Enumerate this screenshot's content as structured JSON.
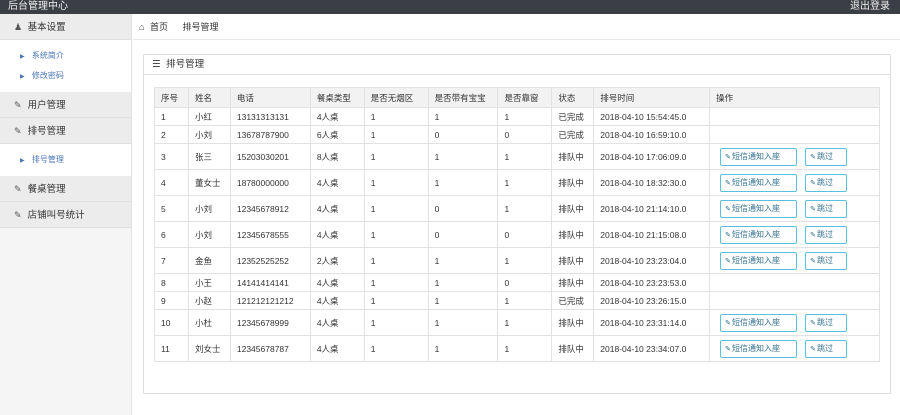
{
  "app": {
    "title": "后台管理中心",
    "logout": "退出登录"
  },
  "sidebar": {
    "groups": [
      {
        "label": "基本设置",
        "icon": "user-icon"
      },
      {
        "label": "用户管理",
        "icon": "edit-icon"
      },
      {
        "label": "排号管理",
        "icon": "edit-icon"
      },
      {
        "label": "餐桌管理",
        "icon": "edit-icon"
      },
      {
        "label": "店铺叫号统计",
        "icon": "edit-icon"
      }
    ],
    "subitems": [
      {
        "label": "系统简介"
      },
      {
        "label": "修改密码"
      },
      {
        "label": "排号管理"
      }
    ]
  },
  "breadcrumb": {
    "home": "首页",
    "current": "排号管理"
  },
  "panel": {
    "title": "排号管理"
  },
  "table": {
    "headers": [
      "序号",
      "姓名",
      "电话",
      "餐桌类型",
      "是否无烟区",
      "是否带有宝宝",
      "是否靠窗",
      "状态",
      "排号时间",
      "操作"
    ],
    "rows": [
      {
        "no": "1",
        "name": "小红",
        "phone": "13131313131",
        "table": "4人桌",
        "smoke": "1",
        "baby": "1",
        "window": "1",
        "status": "已完成",
        "time": "2018-04-10 15:54:45.0",
        "actions": false
      },
      {
        "no": "2",
        "name": "小刘",
        "phone": "13678787900",
        "table": "6人桌",
        "smoke": "1",
        "baby": "0",
        "window": "0",
        "status": "已完成",
        "time": "2018-04-10 16:59:10.0",
        "actions": false
      },
      {
        "no": "3",
        "name": "张三",
        "phone": "15203030201",
        "table": "8人桌",
        "smoke": "1",
        "baby": "1",
        "window": "1",
        "status": "排队中",
        "time": "2018-04-10 17:06:09.0",
        "actions": true
      },
      {
        "no": "4",
        "name": "董女士",
        "phone": "18780000000",
        "table": "4人桌",
        "smoke": "1",
        "baby": "1",
        "window": "1",
        "status": "排队中",
        "time": "2018-04-10 18:32:30.0",
        "actions": true
      },
      {
        "no": "5",
        "name": "小刘",
        "phone": "12345678912",
        "table": "4人桌",
        "smoke": "1",
        "baby": "0",
        "window": "1",
        "status": "排队中",
        "time": "2018-04-10 21:14:10.0",
        "actions": true
      },
      {
        "no": "6",
        "name": "小刘",
        "phone": "12345678555",
        "table": "4人桌",
        "smoke": "1",
        "baby": "0",
        "window": "0",
        "status": "排队中",
        "time": "2018-04-10 21:15:08.0",
        "actions": true
      },
      {
        "no": "7",
        "name": "金鱼",
        "phone": "12352525252",
        "table": "2人桌",
        "smoke": "1",
        "baby": "1",
        "window": "1",
        "status": "排队中",
        "time": "2018-04-10 23:23:04.0",
        "actions": true
      },
      {
        "no": "8",
        "name": "小王",
        "phone": "14141414141",
        "table": "4人桌",
        "smoke": "1",
        "baby": "1",
        "window": "0",
        "status": "排队中",
        "time": "2018-04-10 23:23:53.0",
        "actions": false
      },
      {
        "no": "9",
        "name": "小赵",
        "phone": "121212121212",
        "table": "4人桌",
        "smoke": "1",
        "baby": "1",
        "window": "1",
        "status": "已完成",
        "time": "2018-04-10 23:26:15.0",
        "actions": false
      },
      {
        "no": "10",
        "name": "小杜",
        "phone": "12345678999",
        "table": "4人桌",
        "smoke": "1",
        "baby": "1",
        "window": "1",
        "status": "排队中",
        "time": "2018-04-10 23:31:14.0",
        "actions": true
      },
      {
        "no": "11",
        "name": "刘女士",
        "phone": "12345678787",
        "table": "4人桌",
        "smoke": "1",
        "baby": "1",
        "window": "1",
        "status": "排队中",
        "time": "2018-04-10 23:34:07.0",
        "actions": true
      }
    ],
    "notify_label": "短信通知入座",
    "skip_label": "跳过"
  },
  "colors": {
    "topbar": "#3b3e45",
    "accent": "#5bc0de",
    "link": "#4a76b5"
  }
}
